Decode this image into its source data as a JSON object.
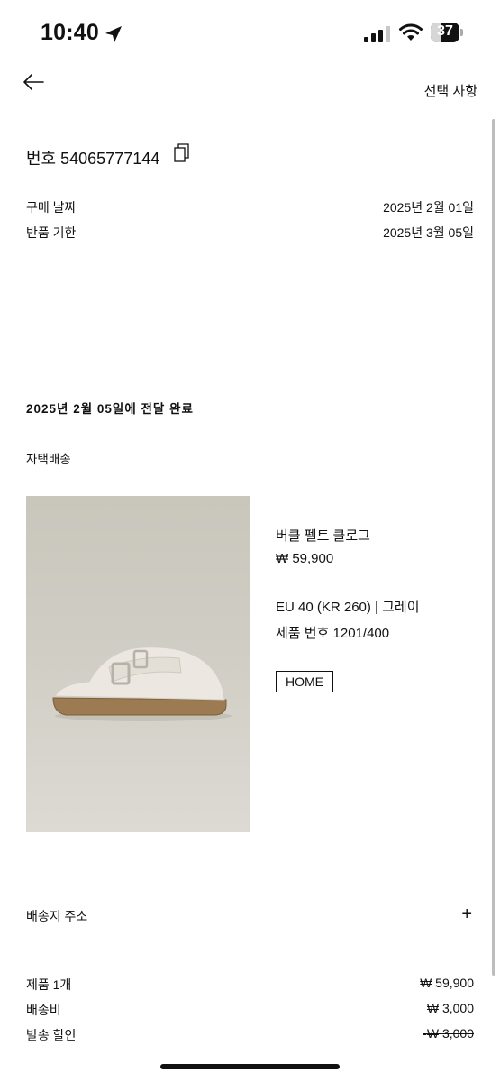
{
  "status_bar": {
    "time": "10:40",
    "battery": "37",
    "battery_level": 0.37,
    "icons": [
      "location-arrow-icon",
      "cellular-signal-icon",
      "wifi-icon",
      "battery-icon"
    ]
  },
  "header": {
    "back_icon": "arrow-left-icon",
    "options_label": "선택 사항"
  },
  "order": {
    "number_label": "번호 54065777144",
    "copy_icon": "copy-icon",
    "purchase_date_label": "구매 날짜",
    "purchase_date_value": "2025년 2월 01일",
    "return_deadline_label": "반품 기한",
    "return_deadline_value": "2025년 3월 05일"
  },
  "shipment": {
    "status": "2025년 2월 05일에 전달 완료",
    "method": "자택배송"
  },
  "product": {
    "name": "버클 펠트 클로그",
    "price": "₩ 59,900",
    "size_color": "EU 40 (KR 260) | 그레이",
    "reference": "제품 번호 1201/400",
    "tag": "HOME"
  },
  "address": {
    "label": "배송지 주소",
    "expand_icon": "plus-icon"
  },
  "summary": [
    {
      "label": "제품 1개",
      "value": "₩ 59,900",
      "strike": false
    },
    {
      "label": "배송비",
      "value": "₩ 3,000",
      "strike": false
    },
    {
      "label": "발송 할인",
      "value": "-₩ 3,000",
      "strike": true
    }
  ],
  "colors": {
    "text": "#111111",
    "image_bg": "#cbc8be",
    "scrollbar": "#bdbdbd"
  }
}
